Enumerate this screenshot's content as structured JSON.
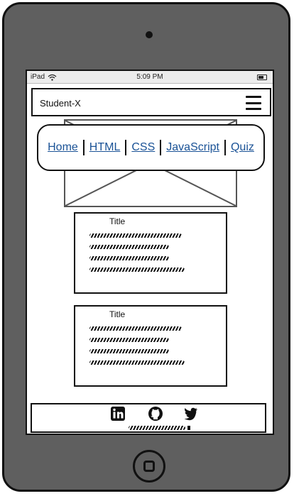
{
  "statusbar": {
    "device": "iPad",
    "time": "5:09 PM"
  },
  "header": {
    "brand": "Student-X",
    "menu_icon": "hamburger-icon"
  },
  "nav": {
    "links": [
      {
        "label": "Home"
      },
      {
        "label": "HTML"
      },
      {
        "label": "CSS"
      },
      {
        "label": "JavaScript"
      },
      {
        "label": "Quiz"
      }
    ],
    "link_color": "#1a5296"
  },
  "cards": [
    {
      "title": "Title"
    },
    {
      "title": "Title"
    }
  ],
  "footer": {
    "icons": [
      "linkedin-icon",
      "github-icon",
      "twitter-icon"
    ]
  }
}
